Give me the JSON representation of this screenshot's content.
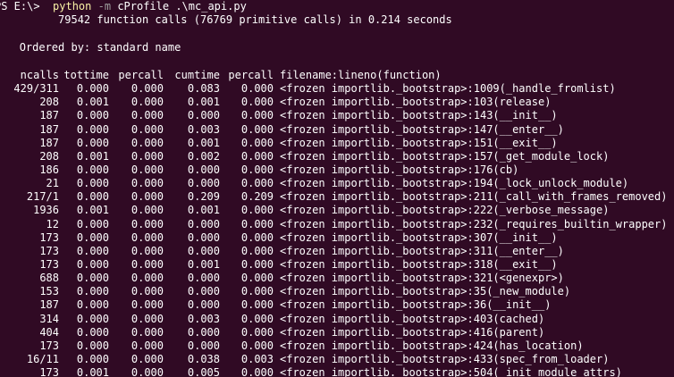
{
  "prompt": {
    "ps": "PS E:\\>",
    "command": "python",
    "flag": "-m",
    "args": "cProfile .\\mc_api.py"
  },
  "summary": "79542 function calls (76769 primitive calls) in 0.214 seconds",
  "ordered_by": "Ordered by: standard name",
  "columns": [
    "ncalls",
    "tottime",
    "percall",
    "cumtime",
    "percall",
    "filename:lineno(function)"
  ],
  "rows": [
    {
      "ncalls": "429/311",
      "tottime": "0.000",
      "percall1": "0.000",
      "cumtime": "0.083",
      "percall2": "0.000",
      "func": "<frozen importlib._bootstrap>:1009(_handle_fromlist)"
    },
    {
      "ncalls": "208",
      "tottime": "0.001",
      "percall1": "0.000",
      "cumtime": "0.001",
      "percall2": "0.000",
      "func": "<frozen importlib._bootstrap>:103(release)"
    },
    {
      "ncalls": "187",
      "tottime": "0.000",
      "percall1": "0.000",
      "cumtime": "0.000",
      "percall2": "0.000",
      "func": "<frozen importlib._bootstrap>:143(__init__)"
    },
    {
      "ncalls": "187",
      "tottime": "0.000",
      "percall1": "0.000",
      "cumtime": "0.003",
      "percall2": "0.000",
      "func": "<frozen importlib._bootstrap>:147(__enter__)"
    },
    {
      "ncalls": "187",
      "tottime": "0.000",
      "percall1": "0.000",
      "cumtime": "0.001",
      "percall2": "0.000",
      "func": "<frozen importlib._bootstrap>:151(__exit__)"
    },
    {
      "ncalls": "208",
      "tottime": "0.001",
      "percall1": "0.000",
      "cumtime": "0.002",
      "percall2": "0.000",
      "func": "<frozen importlib._bootstrap>:157(_get_module_lock)"
    },
    {
      "ncalls": "186",
      "tottime": "0.000",
      "percall1": "0.000",
      "cumtime": "0.000",
      "percall2": "0.000",
      "func": "<frozen importlib._bootstrap>:176(cb)"
    },
    {
      "ncalls": "21",
      "tottime": "0.000",
      "percall1": "0.000",
      "cumtime": "0.000",
      "percall2": "0.000",
      "func": "<frozen importlib._bootstrap>:194(_lock_unlock_module)"
    },
    {
      "ncalls": "217/1",
      "tottime": "0.000",
      "percall1": "0.000",
      "cumtime": "0.209",
      "percall2": "0.209",
      "func": "<frozen importlib._bootstrap>:211(_call_with_frames_removed)"
    },
    {
      "ncalls": "1936",
      "tottime": "0.001",
      "percall1": "0.000",
      "cumtime": "0.001",
      "percall2": "0.000",
      "func": "<frozen importlib._bootstrap>:222(_verbose_message)"
    },
    {
      "ncalls": "12",
      "tottime": "0.000",
      "percall1": "0.000",
      "cumtime": "0.000",
      "percall2": "0.000",
      "func": "<frozen importlib._bootstrap>:232(_requires_builtin_wrapper)"
    },
    {
      "ncalls": "173",
      "tottime": "0.000",
      "percall1": "0.000",
      "cumtime": "0.000",
      "percall2": "0.000",
      "func": "<frozen importlib._bootstrap>:307(__init__)"
    },
    {
      "ncalls": "173",
      "tottime": "0.000",
      "percall1": "0.000",
      "cumtime": "0.000",
      "percall2": "0.000",
      "func": "<frozen importlib._bootstrap>:311(__enter__)"
    },
    {
      "ncalls": "173",
      "tottime": "0.000",
      "percall1": "0.000",
      "cumtime": "0.001",
      "percall2": "0.000",
      "func": "<frozen importlib._bootstrap>:318(__exit__)"
    },
    {
      "ncalls": "688",
      "tottime": "0.000",
      "percall1": "0.000",
      "cumtime": "0.000",
      "percall2": "0.000",
      "func": "<frozen importlib._bootstrap>:321(<genexpr>)"
    },
    {
      "ncalls": "153",
      "tottime": "0.000",
      "percall1": "0.000",
      "cumtime": "0.000",
      "percall2": "0.000",
      "func": "<frozen importlib._bootstrap>:35(_new_module)"
    },
    {
      "ncalls": "187",
      "tottime": "0.000",
      "percall1": "0.000",
      "cumtime": "0.000",
      "percall2": "0.000",
      "func": "<frozen importlib._bootstrap>:36(__init__)"
    },
    {
      "ncalls": "314",
      "tottime": "0.000",
      "percall1": "0.000",
      "cumtime": "0.003",
      "percall2": "0.000",
      "func": "<frozen importlib._bootstrap>:403(cached)"
    },
    {
      "ncalls": "404",
      "tottime": "0.000",
      "percall1": "0.000",
      "cumtime": "0.000",
      "percall2": "0.000",
      "func": "<frozen importlib._bootstrap>:416(parent)"
    },
    {
      "ncalls": "173",
      "tottime": "0.000",
      "percall1": "0.000",
      "cumtime": "0.000",
      "percall2": "0.000",
      "func": "<frozen importlib._bootstrap>:424(has_location)"
    },
    {
      "ncalls": "16/11",
      "tottime": "0.000",
      "percall1": "0.000",
      "cumtime": "0.038",
      "percall2": "0.003",
      "func": "<frozen importlib._bootstrap>:433(spec_from_loader)"
    },
    {
      "ncalls": "173",
      "tottime": "0.001",
      "percall1": "0.000",
      "cumtime": "0.005",
      "percall2": "0.000",
      "func": "<frozen importlib._bootstrap>:504(_init_module_attrs)"
    }
  ],
  "colors": {
    "background": "#300a24",
    "text": "#ffffff",
    "command": "#f9f1a5",
    "flag": "#9f9f9f"
  }
}
